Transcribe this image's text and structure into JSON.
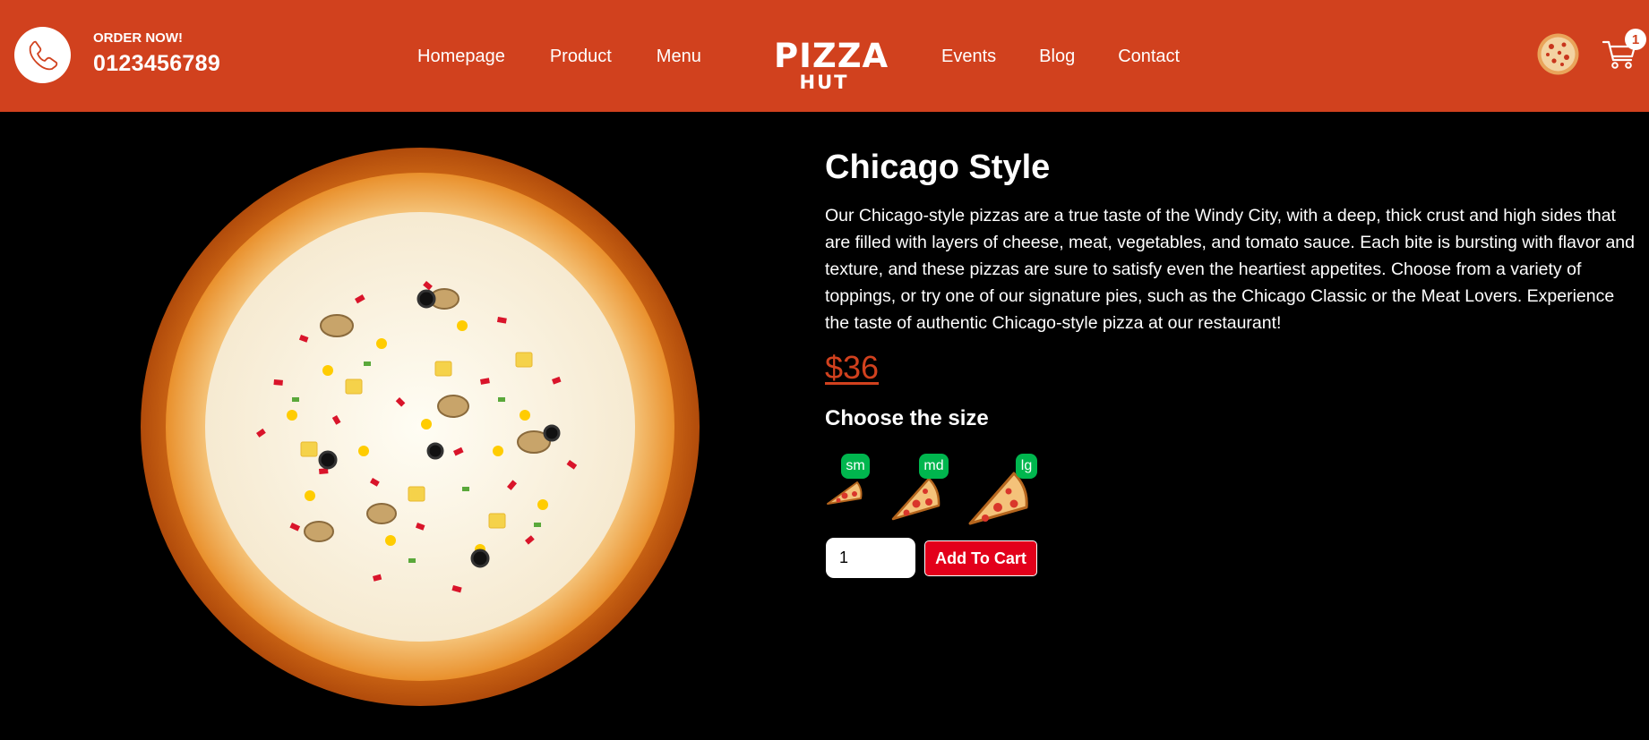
{
  "header": {
    "call_label": "ORDER NOW!",
    "call_number": "0123456789",
    "nav_left": [
      "Homepage",
      "Product",
      "Menu"
    ],
    "logo_line1": "PIZZA",
    "logo_line2": "HUT",
    "nav_right": [
      "Events",
      "Blog",
      "Contact"
    ],
    "cart_count": "1",
    "icons": {
      "call": "phone-icon",
      "cart": "cart-icon",
      "profile": "pizza-avatar"
    }
  },
  "product": {
    "title": "Chicago Style",
    "description": "Our Chicago-style pizzas are a true taste of the Windy City, with a deep, thick crust and high sides that are filled with layers of cheese, meat, vegetables, and tomato sauce. Each bite is bursting with flavor and texture, and these pizzas are sure to satisfy even the heartiest appetites. Choose from a variety of toppings, or try one of our signature pies, such as the Chicago Classic or the Meat Lovers. Experience the taste of authentic Chicago-style pizza at our restaurant!",
    "price": "$36",
    "size_title": "Choose the size",
    "sizes": [
      "sm",
      "md",
      "lg"
    ],
    "quantity": "1",
    "add_to_cart": "Add To Cart"
  },
  "colors": {
    "header_bg": "#d1411e",
    "page_bg": "#000000",
    "price": "#d1411e",
    "size_badge": "#00b64e",
    "add_button": "#e3001b"
  }
}
